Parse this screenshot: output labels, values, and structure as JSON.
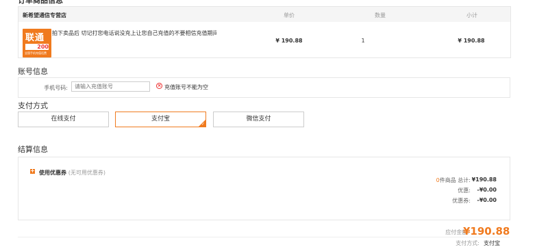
{
  "order": {
    "section_title": "订单商品信息",
    "shop_name": "新希望通信专营店",
    "columns": {
      "price": "单价",
      "quantity": "数量",
      "subtotal": "小计"
    },
    "items": [
      {
        "thumb_brand": "联通",
        "thumb_amount": "200",
        "thumb_note": "全国手机充值话费",
        "title": "拍下卖品后 切记打您电话说没充上让您自己充值的不要相信充值期间不...",
        "price": "¥ 190.88",
        "quantity": "1",
        "subtotal": "¥ 190.88"
      }
    ]
  },
  "account": {
    "section_title": "账号信息",
    "phone_label": "手机号码:",
    "phone_placeholder": "请输入充值账号",
    "phone_value": "",
    "error_text": "充值账号不能为空"
  },
  "payment": {
    "section_title": "支付方式",
    "options": [
      {
        "label": "在线支付",
        "selected": false
      },
      {
        "label": "支付宝",
        "selected": true
      },
      {
        "label": "微信支付",
        "selected": false
      }
    ]
  },
  "settlement": {
    "section_title": "结算信息",
    "coupon_label": "使用优惠券",
    "coupon_note": "(无可用优惠券)",
    "count_prefix": "0",
    "count_suffix": "件商品 总计:",
    "total_value": "¥190.88",
    "discount_label": "优惠:",
    "discount_value": "-¥0.00",
    "coupon_deduct_label": "优惠券:",
    "coupon_deduct_value": "-¥0.00"
  },
  "summary": {
    "payable_label": "应付金额:",
    "payable_value": "¥190.88",
    "method_label": "支付方式:",
    "method_value": "支付宝"
  },
  "colors": {
    "accent": "#f07a1e",
    "error": "#e33333",
    "border": "#e6e6e6"
  }
}
